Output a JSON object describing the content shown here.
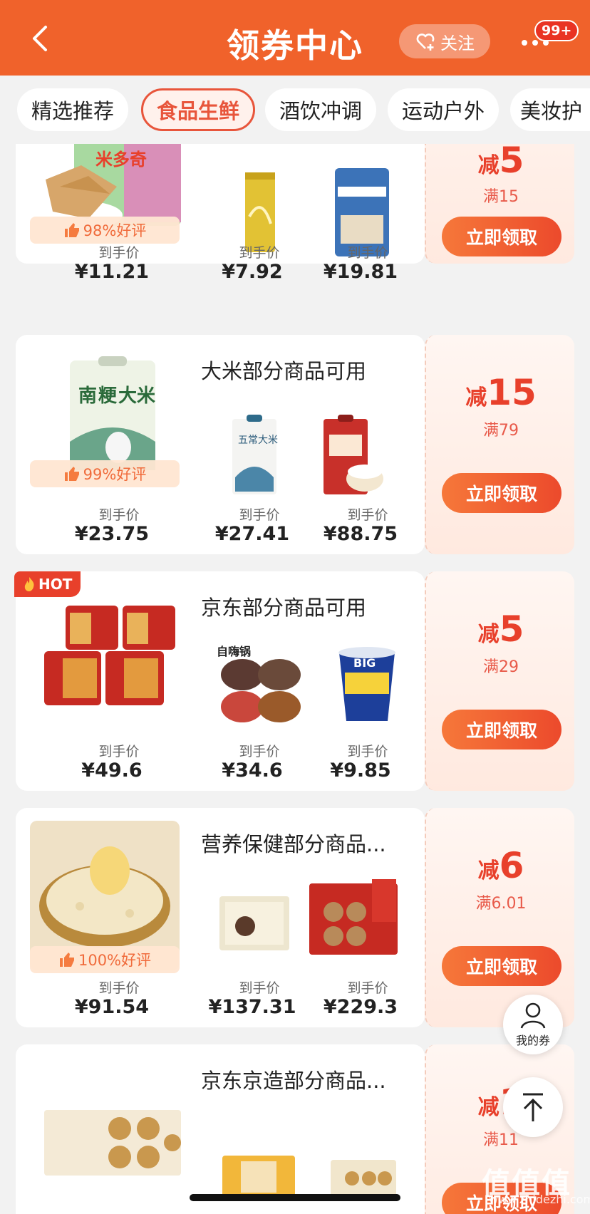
{
  "header": {
    "title": "领券中心",
    "follow_label": "关注",
    "badge": "99+"
  },
  "tabs": [
    {
      "label": "精选推荐",
      "active": false
    },
    {
      "label": "食品生鲜",
      "active": true
    },
    {
      "label": "酒饮冲调",
      "active": false
    },
    {
      "label": "运动户外",
      "active": false
    },
    {
      "label": "美妆护",
      "active": false
    }
  ],
  "price_label": "到手价",
  "claim_label": "立即领取",
  "hot_label": "HOT",
  "cards": [
    {
      "title": "",
      "rating": "98%好评",
      "prices": [
        "¥11.21",
        "¥7.92",
        "¥19.81"
      ],
      "discount_prefix": "减",
      "discount_value": "5",
      "threshold": "满15"
    },
    {
      "title": "大米部分商品可用",
      "rating": "99%好评",
      "prices": [
        "¥23.75",
        "¥27.41",
        "¥88.75"
      ],
      "discount_prefix": "减",
      "discount_value": "15",
      "threshold": "满79"
    },
    {
      "title": "京东部分商品可用",
      "rating": "",
      "prices": [
        "¥49.6",
        "¥34.6",
        "¥9.85"
      ],
      "discount_prefix": "减",
      "discount_value": "5",
      "threshold": "满29"
    },
    {
      "title": "营养保健部分商品...",
      "rating": "100%好评",
      "prices": [
        "¥91.54",
        "¥137.31",
        "¥229.3"
      ],
      "discount_prefix": "减",
      "discount_value": "6",
      "threshold": "满6.01"
    },
    {
      "title": "京东京造部分商品...",
      "rating": "",
      "prices": [
        "",
        "",
        ""
      ],
      "discount_prefix": "减",
      "discount_value": "1",
      "threshold": "满11"
    }
  ],
  "floating": {
    "my_coupons_label": "我的券"
  },
  "watermark": {
    "main": "值值值",
    "sub": "www.zhidezhi.com"
  },
  "colors": {
    "header_bg": "#f0622b",
    "accent": "#e8402b",
    "active_tab": "#e8553b",
    "page_bg": "#f2f2f2"
  }
}
